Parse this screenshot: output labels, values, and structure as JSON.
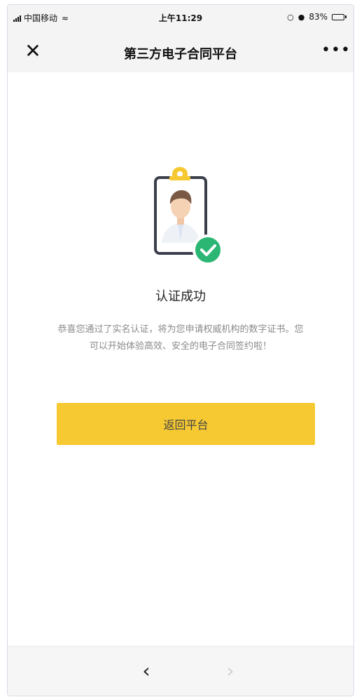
{
  "status_bar": {
    "carrier": "中国移动",
    "time": "上午11:29",
    "battery": "83%"
  },
  "nav": {
    "title": "第三方电子合同平台",
    "close_icon": "close-icon",
    "more_icon": "more-icon"
  },
  "result": {
    "icon": "id-badge-check-icon",
    "title": "认证成功",
    "description": "恭喜您通过了实名认证，将为您申请权威机构的数字证书。您可以开始体验高效、安全的电子合同签约啦！",
    "button_label": "返回平台"
  },
  "colors": {
    "accent": "#f6c932",
    "success": "#2bb673"
  },
  "toolbar": {
    "back_icon": "chevron-left-icon",
    "forward_icon": "chevron-right-icon"
  }
}
